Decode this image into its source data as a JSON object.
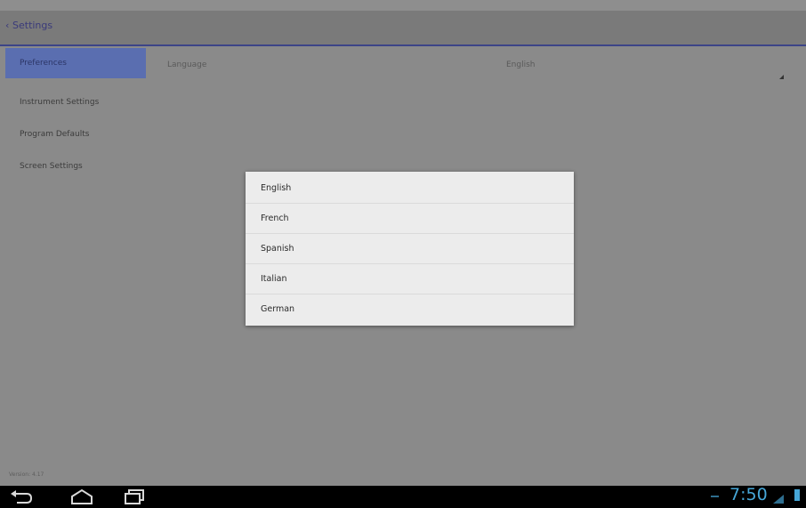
{
  "actionbar": {
    "back_caret": "‹",
    "title": "Settings"
  },
  "sidebar": {
    "items": [
      {
        "label": "Preferences"
      },
      {
        "label": "Instrument Settings"
      },
      {
        "label": "Program Defaults"
      },
      {
        "label": "Screen Settings"
      }
    ]
  },
  "version": "Version: 4.17",
  "preference": {
    "label": "Language",
    "value": "English"
  },
  "dialog": {
    "options": [
      "English",
      "French",
      "Spanish",
      "Italian",
      "German"
    ]
  },
  "statusbar": {
    "time": "7:50"
  },
  "colors": {
    "accent": "#3c4487",
    "selected_item": "#5a6eb0",
    "clock": "#46a7d8",
    "dialog_bg": "#ececec"
  },
  "icons": [
    "back-icon",
    "home-icon",
    "recent-apps-icon",
    "wifi-icon",
    "signal-icon",
    "battery-icon"
  ]
}
